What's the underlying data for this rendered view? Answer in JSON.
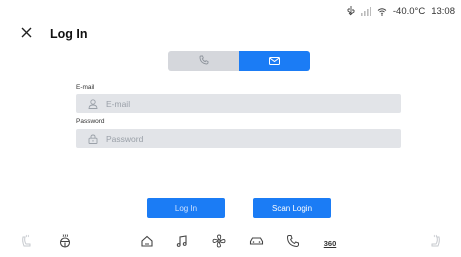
{
  "status_bar": {
    "icons": [
      "usb-icon",
      "signal-icon",
      "wifi-icon"
    ],
    "temperature": "-40.0°C",
    "time": "13:08"
  },
  "header": {
    "close_icon": "close-icon",
    "title": "Log In"
  },
  "login_method_tabs": [
    {
      "name": "phone",
      "icon": "phone-icon",
      "selected": false
    },
    {
      "name": "email",
      "icon": "envelope-icon",
      "selected": true
    }
  ],
  "form": {
    "email": {
      "label": "E-mail",
      "placeholder": "E-mail",
      "value": "",
      "icon": "user-icon"
    },
    "password": {
      "label": "Password",
      "placeholder": "Password",
      "value": "",
      "icon": "lock-icon"
    }
  },
  "buttons": {
    "login_label": "Log In",
    "scan_login_label": "Scan Login"
  },
  "dock": {
    "items": [
      "seat-heat-left-icon",
      "steering-wheel-heat-icon",
      "home-icon",
      "music-icon",
      "fan-icon",
      "car-icon",
      "phone-icon",
      "360-view",
      "seat-heat-right-icon"
    ],
    "view_360_label": "360"
  },
  "colors": {
    "accent": "#1b7cf5",
    "field_bg": "#e2e4e8",
    "inactive_tab": "#d5d7dc"
  }
}
